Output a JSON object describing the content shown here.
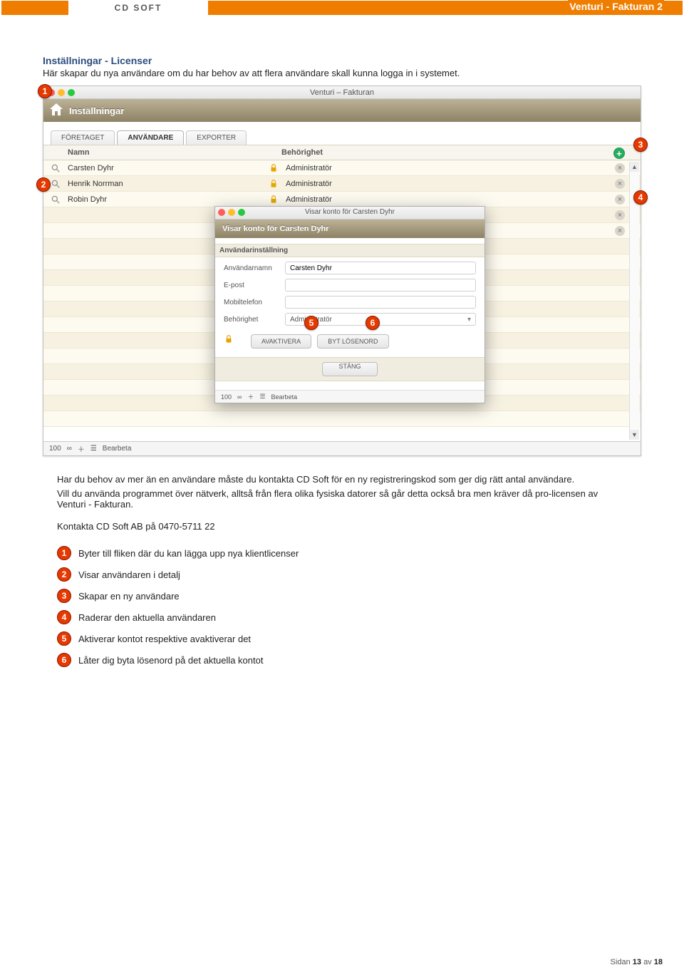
{
  "doc_title": "Venturi - Fakturan 2",
  "logo_text": "CD SOFT",
  "section_title": "Inställningar - Licenser",
  "section_sub": "Här skapar du nya användare om du har behov av att flera användare skall kunna logga in i systemet.",
  "app": {
    "window_title": "Venturi – Fakturan",
    "ribbon_title": "Inställningar",
    "tabs": [
      "FÖRETAGET",
      "ANVÄNDARE",
      "EXPORTER"
    ],
    "active_tab_index": 1,
    "list": {
      "col_name": "Namn",
      "col_behorighet": "Behörighet"
    },
    "rows": [
      {
        "name": "Carsten Dyhr",
        "role": "Administratör"
      },
      {
        "name": "Henrik Norrman",
        "role": "Administratör"
      },
      {
        "name": "Robin Dyhr",
        "role": "Administratör"
      }
    ],
    "status": {
      "count": "100",
      "bearbeta": "Bearbeta"
    },
    "dialog": {
      "title": "Visar konto för Carsten Dyhr",
      "ribbon": "Visar konto för Carsten Dyhr",
      "section_caption": "Användarinställning",
      "fields": {
        "username_label": "Användarnamn",
        "username_value": "Carsten Dyhr",
        "email_label": "E-post",
        "email_value": "",
        "mobile_label": "Mobiltelefon",
        "mobile_value": "",
        "role_label": "Behörighet",
        "role_value": "Administratör"
      },
      "btn_avaktivera": "AVAKTIVERA",
      "btn_bytlosen": "BYT LÖSENORD",
      "btn_stang": "STÄNG",
      "status": {
        "count": "100",
        "bearbeta": "Bearbeta"
      }
    }
  },
  "below_para1": "Har du behov av mer än en användare måste du kontakta CD Soft  för en ny registreringskod som ger dig rätt antal användare.",
  "below_para2": "Vill du använda programmet över nätverk, alltså från flera olika fysiska datorer så går detta också bra men kräver då pro-licensen av Venturi - Fakturan.",
  "below_para3": "Kontakta CD Soft AB på 0470-5711 22",
  "callouts": {
    "1": "1",
    "2": "2",
    "3": "3",
    "4": "4",
    "5": "5",
    "6": "6"
  },
  "legend": [
    "Byter till fliken där du kan lägga upp nya klientlicenser",
    "Visar användaren i detalj",
    "Skapar en ny användare",
    "Raderar den aktuella användaren",
    "Aktiverar kontot respektive avaktiverar det",
    "Låter dig byta lösenord på det aktuella kontot"
  ],
  "page": {
    "current": "13",
    "total": "18",
    "prefix": "Sidan",
    "sep": "av"
  }
}
